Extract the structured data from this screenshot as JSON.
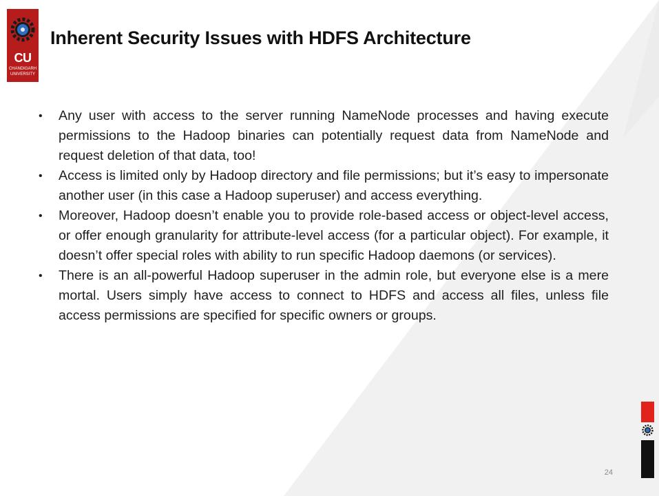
{
  "slide": {
    "title": "Inherent Security Issues with HDFS Architecture",
    "page_number": "24"
  },
  "logo": {
    "abbr": "CU",
    "line1": "CHANDIGARH",
    "line2": "UNIVERSITY"
  },
  "bullets": [
    "Any user with access to the server running NameNode processes and having execute permissions to the Hadoop binaries can potentially request data from NameNode and request deletion of that data, too!",
    "Access is limited only by Hadoop directory and file permissions; but it’s easy to impersonate another user (in this case a Hadoop superuser) and access everything.",
    "Moreover, Hadoop doesn’t enable you to provide role-based access or object-level access, or offer enough granularity for attribute-level access (for a particular object). For example, it doesn’t offer special roles with ability to run specific Hadoop daemons (or services).",
    "There is an all-powerful Hadoop superuser in the admin role, but everyone else is a mere mortal. Users simply have access to connect to HDFS and access all files, unless file access permissions are specified for specific owners or groups."
  ],
  "colors": {
    "brand_red": "#b71c1c",
    "accent_red": "#e0231b",
    "background_shape": "#f1f1f1"
  }
}
